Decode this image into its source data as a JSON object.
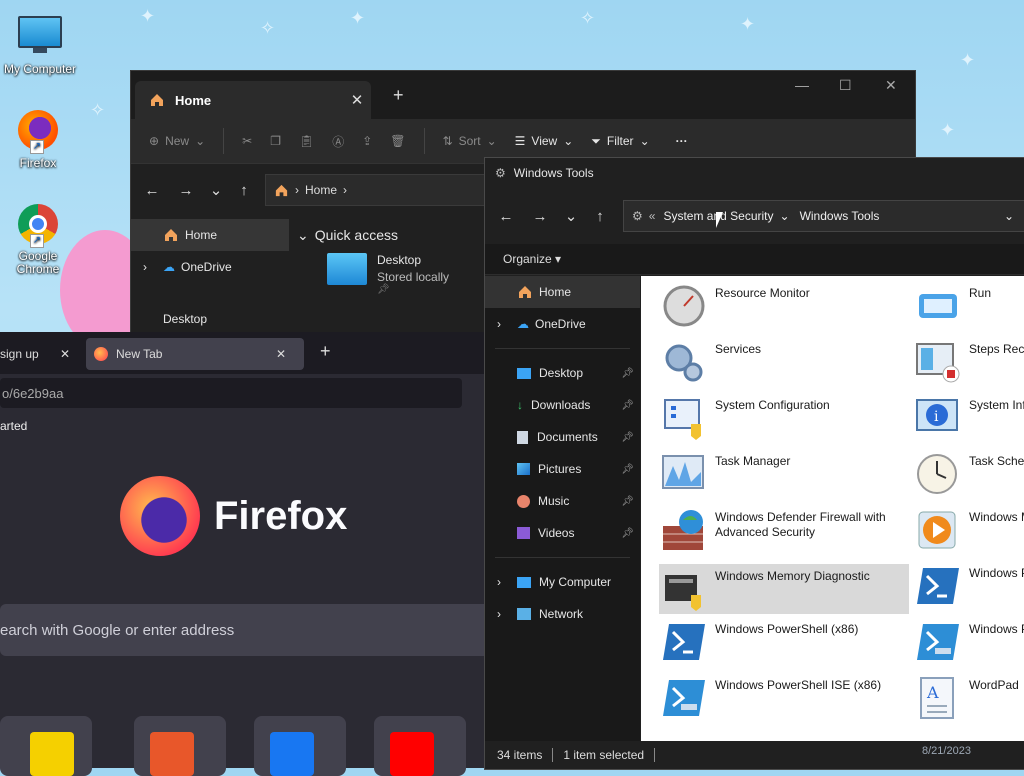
{
  "desktop": {
    "icons": [
      {
        "label": "My Computer"
      },
      {
        "label": "Firefox"
      },
      {
        "label": "Google Chrome"
      }
    ],
    "taskbar_date": "8/21/2023"
  },
  "explorer": {
    "tab_title": "Home",
    "toolbar": {
      "new": "New",
      "sort": "Sort",
      "view": "View",
      "filter": "Filter",
      "more": "···"
    },
    "address": {
      "crumb": "Home"
    },
    "nav": [
      {
        "label": "Home"
      },
      {
        "label": "OneDrive"
      },
      {
        "label": "Desktop"
      }
    ],
    "quick_access": "Quick access",
    "desktop_item": {
      "name": "Desktop",
      "status": "Stored locally"
    }
  },
  "firefox": {
    "tab1": "sign up",
    "tab2": "New Tab",
    "url": "o/6e2b9aa",
    "bookmark": "arted",
    "wordmark": "Firefox",
    "search_placeholder": "earch with Google or enter address"
  },
  "windows_tools": {
    "title": "Windows Tools",
    "breadcrumb": {
      "parent": "System and Security",
      "current": "Windows Tools"
    },
    "organize": "Organize",
    "nav": {
      "home": "Home",
      "onedrive": "OneDrive",
      "desktop": "Desktop",
      "downloads": "Downloads",
      "documents": "Documents",
      "pictures": "Pictures",
      "music": "Music",
      "videos": "Videos",
      "my_computer": "My Computer",
      "network": "Network"
    },
    "tools_left": [
      "Resource Monitor",
      "Services",
      "System Configuration",
      "Task Manager",
      "Windows Defender Firewall with Advanced Security",
      "Windows Memory Diagnostic",
      "Windows PowerShell (x86)",
      "Windows PowerShell ISE (x86)"
    ],
    "tools_right": [
      "Run",
      "Steps Reco",
      "System Inf",
      "Task Sched",
      "Windows M",
      "Windows P",
      "Windows P",
      "WordPad"
    ],
    "status": {
      "items": "34 items",
      "selected": "1 item selected"
    }
  }
}
